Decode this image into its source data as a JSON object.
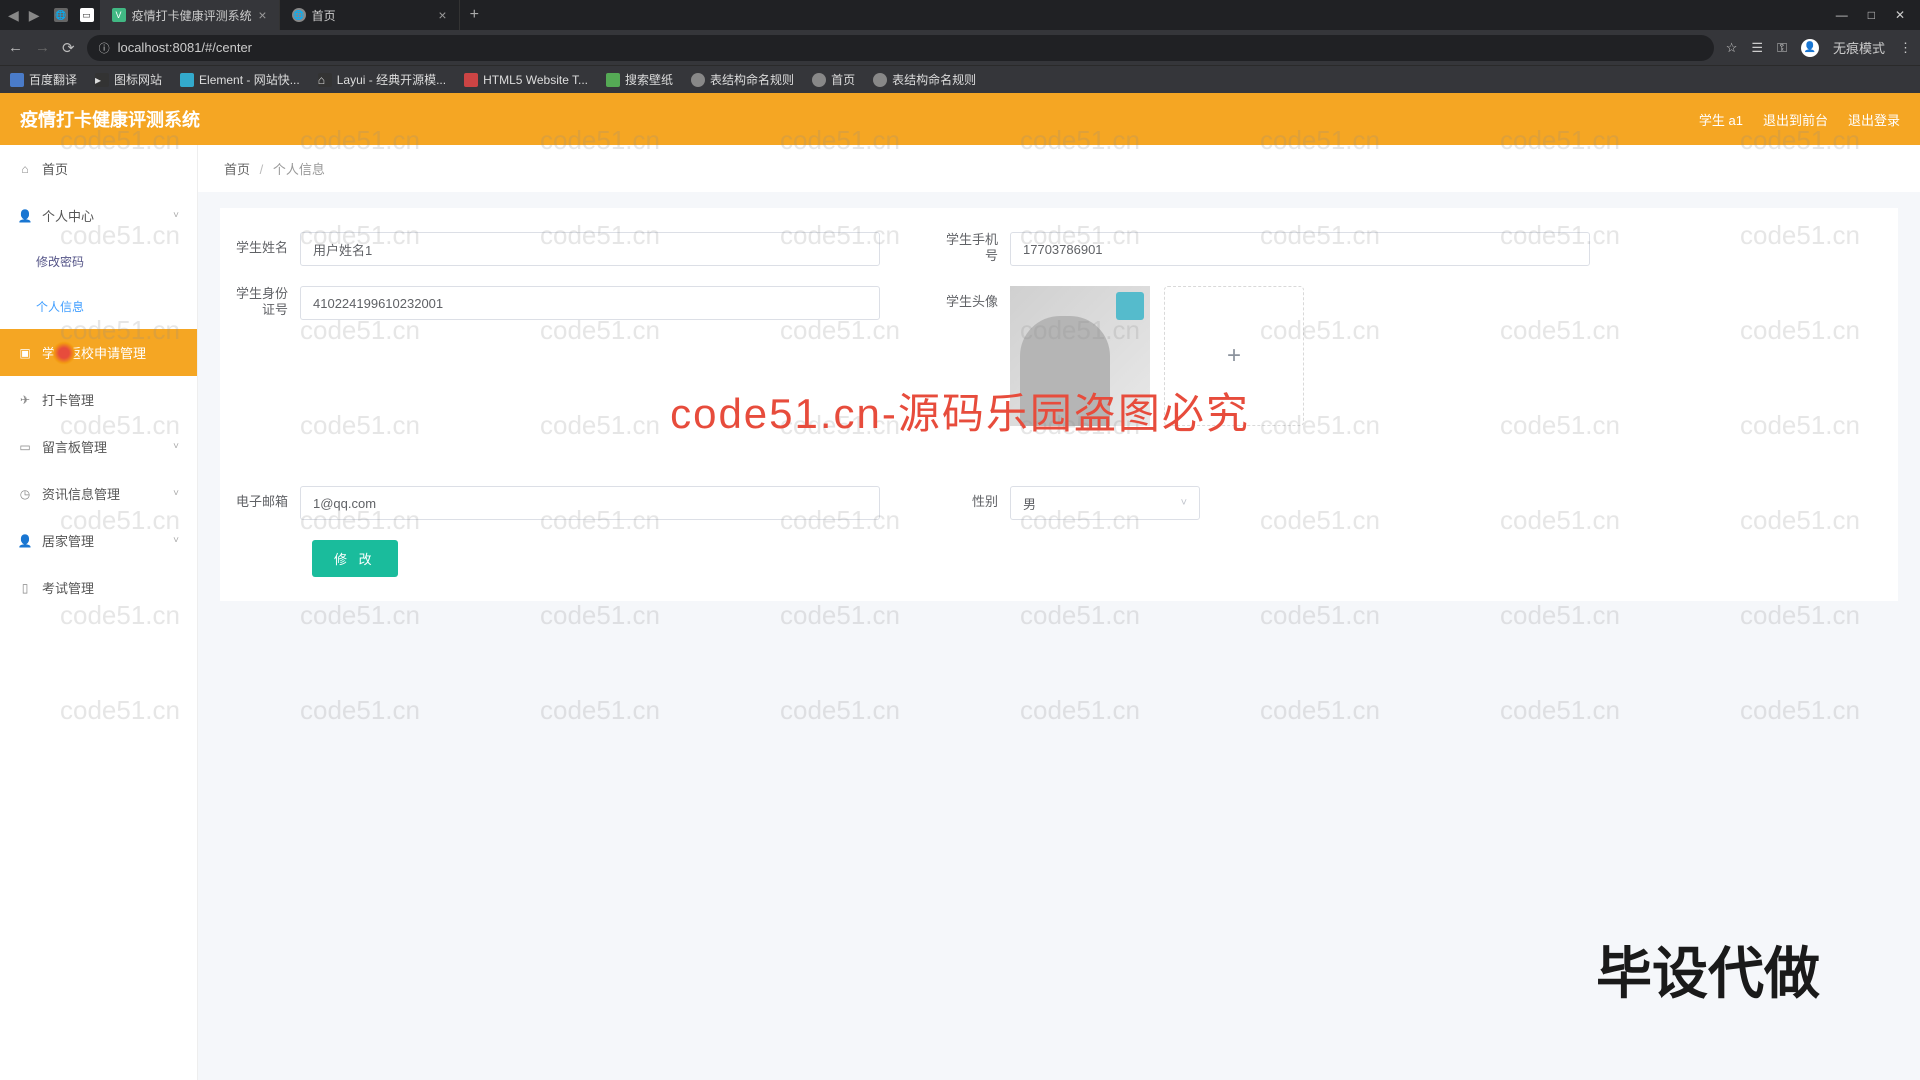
{
  "browser": {
    "tabs": [
      {
        "title": "疫情打卡健康评测系统",
        "active": true
      },
      {
        "title": "首页",
        "active": false
      }
    ],
    "url": "localhost:8081/#/center",
    "incognito_label": "无痕模式",
    "bookmarks": [
      "百度翻译",
      "图标网站",
      "Element - 网站快...",
      "Layui - 经典开源模...",
      "HTML5 Website T...",
      "搜索壁纸",
      "表结构命名规则",
      "首页",
      "表结构命名规则"
    ]
  },
  "header": {
    "title": "疫情打卡健康评测系统",
    "user": "学生 a1",
    "back": "退出到前台",
    "logout": "退出登录"
  },
  "sidebar": {
    "items": [
      {
        "label": "首页",
        "icon": "home"
      },
      {
        "label": "个人中心",
        "icon": "user",
        "expand": true
      },
      {
        "label": "修改密码",
        "sub": true
      },
      {
        "label": "个人信息",
        "sub": true,
        "active": true
      },
      {
        "label": "学生返校申请管理",
        "icon": "box",
        "hl": true
      },
      {
        "label": "打卡管理",
        "icon": "send"
      },
      {
        "label": "留言板管理",
        "icon": "msg",
        "expand": true
      },
      {
        "label": "资讯信息管理",
        "icon": "clock",
        "expand": true
      },
      {
        "label": "居家管理",
        "icon": "user",
        "expand": true
      },
      {
        "label": "考试管理",
        "icon": "doc"
      }
    ]
  },
  "breadcrumb": {
    "home": "首页",
    "current": "个人信息"
  },
  "form": {
    "name_label": "学生姓名",
    "name_value": "用户姓名1",
    "phone_label": "学生手机号",
    "phone_value": "17703786901",
    "id_label": "学生身份证号",
    "id_value": "410224199610232001",
    "avatar_label": "学生头像",
    "email_label": "电子邮箱",
    "email_value": "1@qq.com",
    "gender_label": "性别",
    "gender_value": "男",
    "submit": "修 改",
    "upload_plus": "+"
  },
  "watermark": {
    "text": "code51.cn",
    "big": "code51.cn-源码乐园盗图必究",
    "corner": "毕设代做"
  }
}
